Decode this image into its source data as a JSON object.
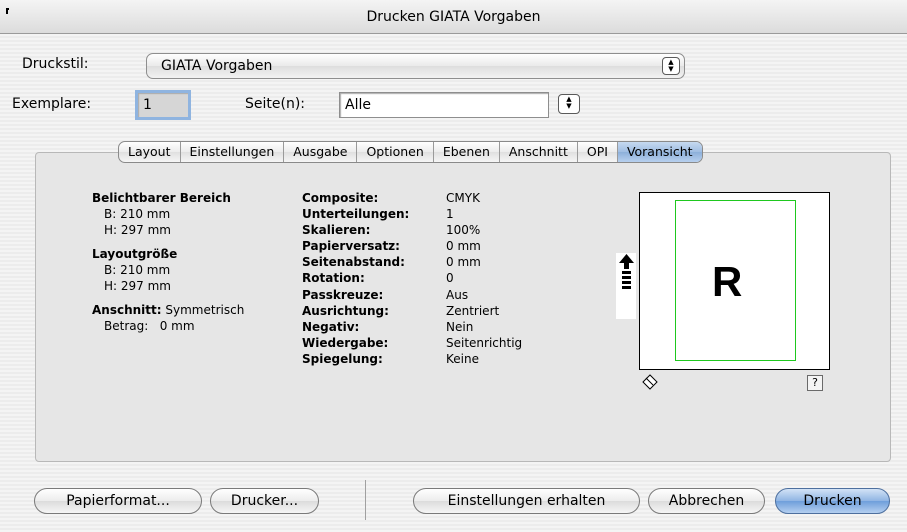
{
  "window": {
    "title": "Drucken GIATA Vorgaben"
  },
  "druckstil": {
    "label": "Druckstil:",
    "value": "GIATA Vorgaben"
  },
  "exemplare": {
    "label": "Exemplare:",
    "value": "1"
  },
  "seiten": {
    "label": "Seite(n):",
    "value": "Alle"
  },
  "tabs": [
    {
      "label": "Layout"
    },
    {
      "label": "Einstellungen"
    },
    {
      "label": "Ausgabe"
    },
    {
      "label": "Optionen"
    },
    {
      "label": "Ebenen"
    },
    {
      "label": "Anschnitt"
    },
    {
      "label": "OPI"
    },
    {
      "label": "Voransicht"
    }
  ],
  "selected_tab": "Voransicht",
  "summary": {
    "belichtbar": {
      "title": "Belichtbarer Bereich",
      "b": "B: 210 mm",
      "h": "H: 297 mm"
    },
    "layoutgroesse": {
      "title": "Layoutgröße",
      "b": "B: 210 mm",
      "h": "H: 297 mm"
    },
    "anschnitt": {
      "label": "Anschnitt:",
      "value": "Symmetrisch",
      "betrag_label": "Betrag:",
      "betrag_value": "0 mm"
    }
  },
  "settings": [
    {
      "label": "Composite:",
      "value": "CMYK"
    },
    {
      "label": "Unterteilungen:",
      "value": "1"
    },
    {
      "label": "Skalieren:",
      "value": "100%"
    },
    {
      "label": "Papierversatz:",
      "value": "0 mm"
    },
    {
      "label": "Seitenabstand:",
      "value": "0 mm"
    },
    {
      "label": "Rotation:",
      "value": "0"
    },
    {
      "label": "Passkreuze:",
      "value": "Aus"
    },
    {
      "label": "Ausrichtung:",
      "value": "Zentriert"
    },
    {
      "label": "Negativ:",
      "value": "Nein"
    },
    {
      "label": "Wiedergabe:",
      "value": "Seitenrichtig"
    },
    {
      "label": "Spiegelung:",
      "value": "Keine"
    }
  ],
  "preview": {
    "letter": "R",
    "page_color": "#1ec81e",
    "help": "?"
  },
  "buttons": {
    "papierformat": "Papierformat...",
    "drucker": "Drucker...",
    "einstellungen": "Einstellungen erhalten",
    "abbrechen": "Abbrechen",
    "drucken": "Drucken"
  }
}
